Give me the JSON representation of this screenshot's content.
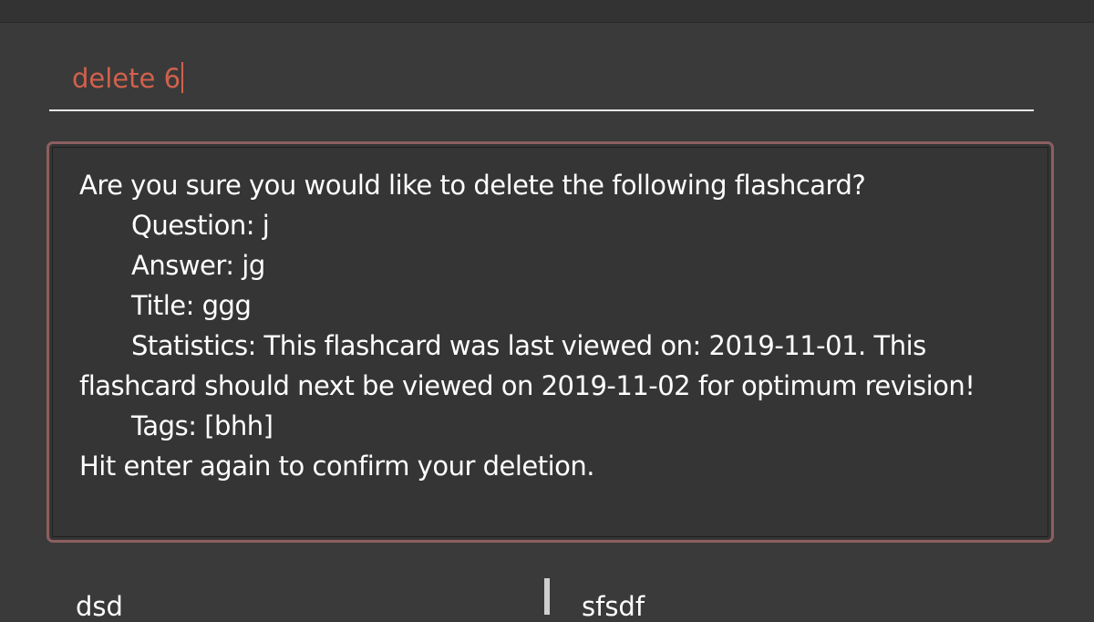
{
  "command": {
    "value": "delete 6"
  },
  "result": {
    "line1": "Are you sure you would like to delete the following flashcard?",
    "question": "Question: j",
    "answer": "Answer: jg",
    "title": "Title: ggg",
    "statistics_a": "Statistics: This flashcard was last viewed on: 2019-11-01. This",
    "statistics_b": "flashcard should next be viewed on 2019-11-02 for optimum revision!",
    "tags": "Tags: [bhh]",
    "confirm": "Hit enter again to confirm your deletion."
  },
  "panels": {
    "left_item": "dsd",
    "right_item": "sfsdf"
  },
  "colors": {
    "background": "#3a3a3a",
    "command_text": "#d1614c",
    "result_border": "#8c5f60",
    "text": "#ffffff"
  }
}
